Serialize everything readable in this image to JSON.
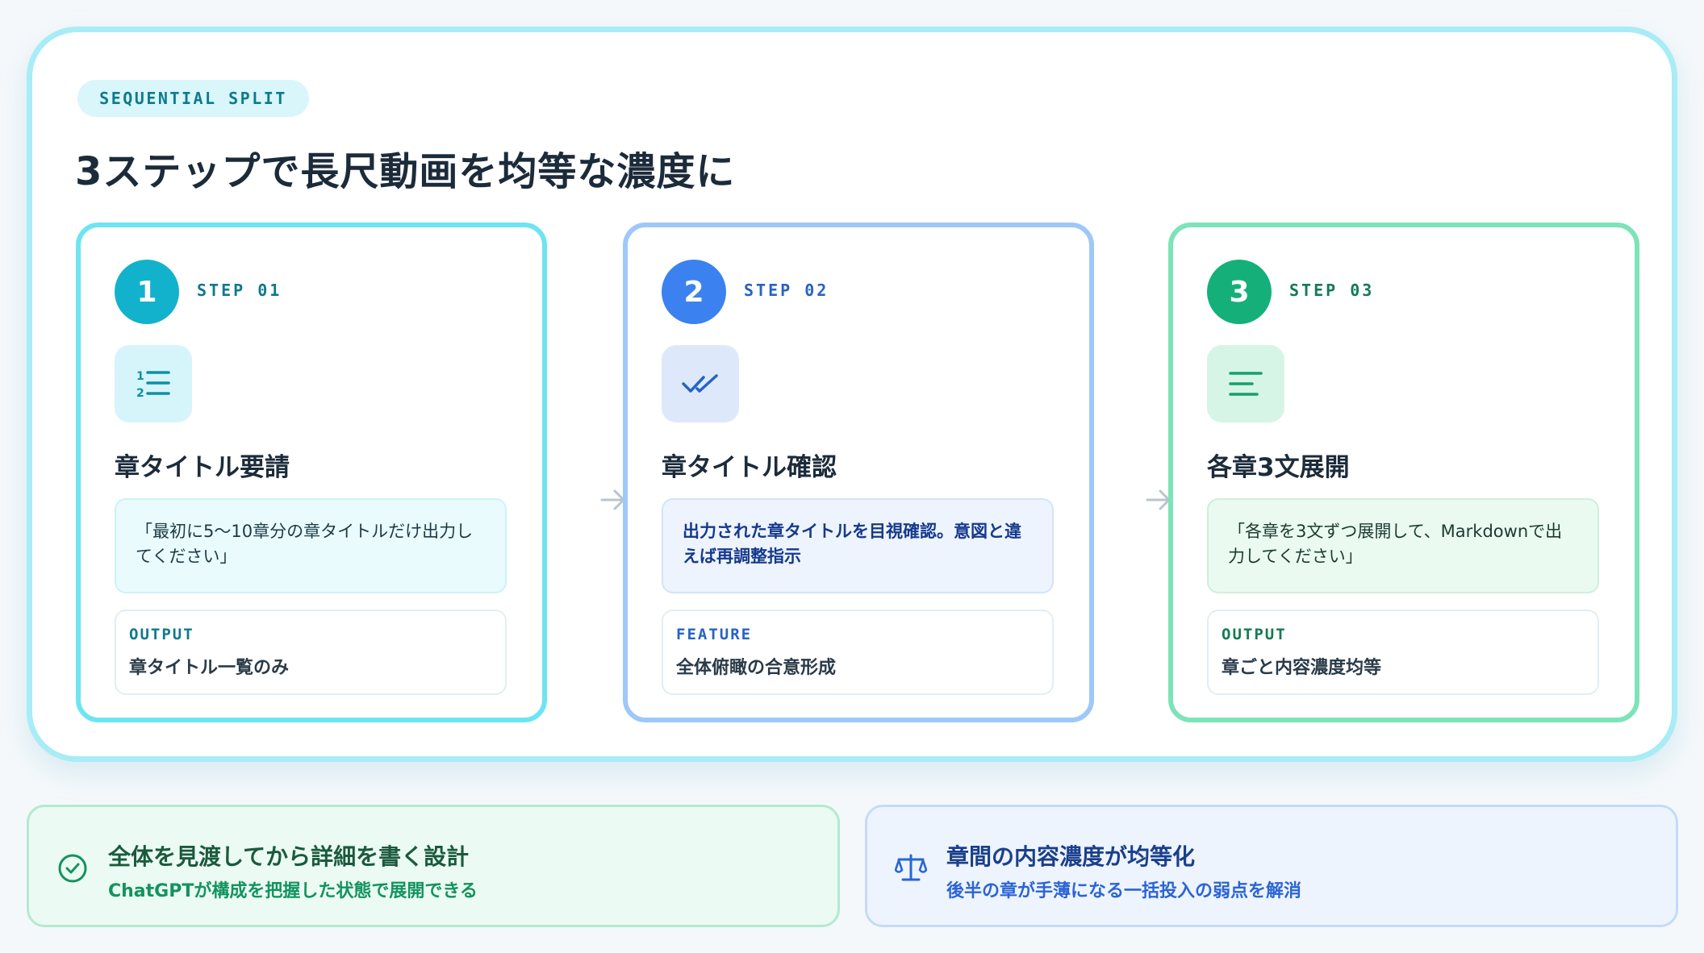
{
  "header": {
    "tag": "SEQUENTIAL SPLIT",
    "title": "3ステップで長尺動画を均等な濃度に"
  },
  "steps": [
    {
      "number": "1",
      "label": "STEP 01",
      "icon": "numbered-list-icon",
      "title": "章タイトル要請",
      "prompt": "「最初に5〜10章分の章タイトルだけ出力してください」",
      "out_label": "OUTPUT",
      "out_value": "章タイトル一覧のみ"
    },
    {
      "number": "2",
      "label": "STEP 02",
      "icon": "double-check-icon",
      "title": "章タイトル確認",
      "prompt": "出力された章タイトルを目視確認。意図と違えば再調整指示",
      "out_label": "FEATURE",
      "out_value": "全体俯瞰の合意形成"
    },
    {
      "number": "3",
      "label": "STEP 03",
      "icon": "align-left-icon",
      "title": "各章3文展開",
      "prompt": "「各章を3文ずつ展開して、Markdownで出力してください」",
      "out_label": "OUTPUT",
      "out_value": "章ごと内容濃度均等"
    }
  ],
  "notes": [
    {
      "icon": "check-circle-icon",
      "title": "全体を見渡してから詳細を書く設計",
      "sub": "ChatGPTが構成を把握した状態で展開できる"
    },
    {
      "icon": "scale-icon",
      "title": "章間の内容濃度が均等化",
      "sub": "後半の章が手薄になる一括投入の弱点を解消"
    }
  ],
  "colors": {
    "step1": "#13b2cc",
    "step2": "#3b82f0",
    "step3": "#15b07a"
  }
}
